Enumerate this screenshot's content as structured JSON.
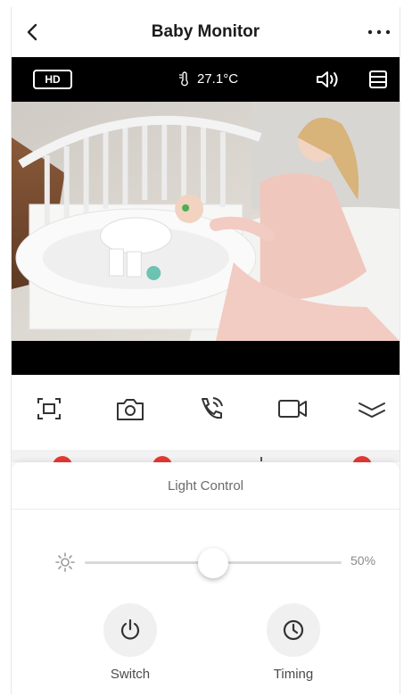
{
  "header": {
    "title": "Baby Monitor",
    "back_icon": "chevron-left-icon",
    "more_icon": "more-horizontal-icon"
  },
  "video": {
    "quality_badge": "HD",
    "temperature": "27.1°C",
    "temperature_icon": "thermometer-icon",
    "speaker_icon": "speaker-icon",
    "layout_icon": "layout-icon"
  },
  "controls": {
    "items": [
      {
        "name": "fullscreen",
        "icon": "fullscreen-icon"
      },
      {
        "name": "snapshot",
        "icon": "camera-icon"
      },
      {
        "name": "talk",
        "icon": "phone-call-icon"
      },
      {
        "name": "record",
        "icon": "video-record-icon"
      },
      {
        "name": "collapse",
        "icon": "chevron-collapse-icon"
      }
    ]
  },
  "light_panel": {
    "title": "Light Control",
    "brightness_icon": "brightness-icon",
    "brightness_value": 50,
    "brightness_label": "50%",
    "switch_label": "Switch",
    "switch_icon": "power-icon",
    "timing_label": "Timing",
    "timing_icon": "clock-icon"
  },
  "colors": {
    "accent_red": "#e53935",
    "panel_bg": "#ffffff",
    "video_bg": "#000000",
    "muted_text": "#6b6b6b"
  }
}
